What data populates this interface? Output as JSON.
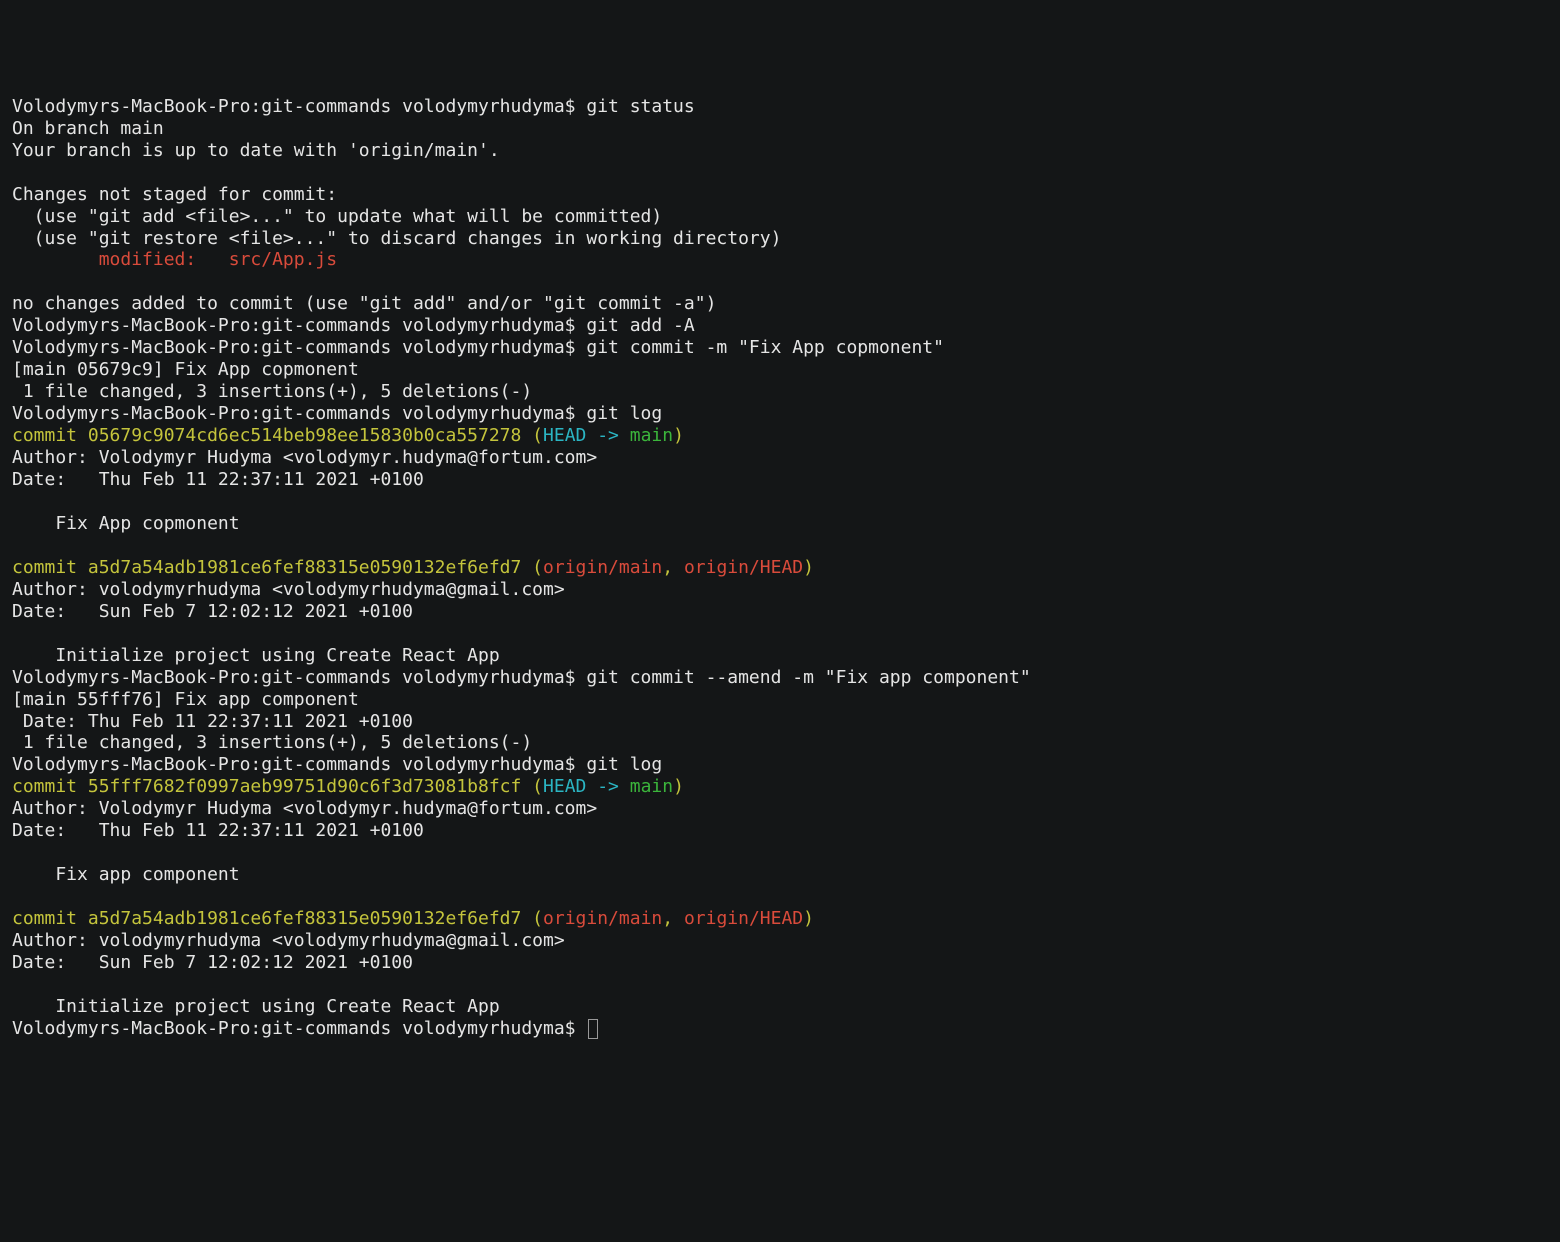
{
  "prompt": "Volodymyrs-MacBook-Pro:git-commands volodymyrhudyma$ ",
  "cmds": {
    "status": "git status",
    "add": "git add -A",
    "commit1": "git commit -m \"Fix App copmonent\"",
    "log1": "git log",
    "amend": "git commit --amend -m \"Fix app component\"",
    "log2": "git log"
  },
  "status": {
    "branch": "On branch main",
    "uptodate": "Your branch is up to date with 'origin/main'.",
    "notstaged": "Changes not staged for commit:",
    "hint_add": "  (use \"git add <file>...\" to update what will be committed)",
    "hint_restore": "  (use \"git restore <file>...\" to discard changes in working directory)",
    "modified": "        modified:   src/App.js",
    "noadded": "no changes added to commit (use \"git add\" and/or \"git commit -a\")"
  },
  "commit_result1": {
    "summary": "[main 05679c9] Fix App copmonent",
    "stats": " 1 file changed, 3 insertions(+), 5 deletions(-)"
  },
  "log_entry1": {
    "commit_prefix": "commit 05679c9074cd6ec514beb98ee15830b0ca557278",
    "paren_open": " (",
    "head": "HEAD -> ",
    "branch": "main",
    "paren_close": ")",
    "author": "Author: Volodymyr Hudyma <volodymyr.hudyma@fortum.com>",
    "date": "Date:   Thu Feb 11 22:37:11 2021 +0100",
    "msg": "    Fix App copmonent"
  },
  "log_entry2": {
    "commit_prefix": "commit a5d7a54adb1981ce6fef88315e0590132ef6efd7",
    "paren_open": " (",
    "remote1": "origin/main",
    "sep": ", ",
    "remote2": "origin/HEAD",
    "paren_close": ")",
    "author": "Author: volodymyrhudyma <volodymyrhudyma@gmail.com>",
    "date": "Date:   Sun Feb 7 12:02:12 2021 +0100",
    "msg": "    Initialize project using Create React App"
  },
  "amend_result": {
    "summary": "[main 55fff76] Fix app component",
    "date": " Date: Thu Feb 11 22:37:11 2021 +0100",
    "stats": " 1 file changed, 3 insertions(+), 5 deletions(-)"
  },
  "log_entry3": {
    "commit_prefix": "commit 55fff7682f0997aeb99751d90c6f3d73081b8fcf",
    "paren_open": " (",
    "head": "HEAD -> ",
    "branch": "main",
    "paren_close": ")",
    "author": "Author: Volodymyr Hudyma <volodymyr.hudyma@fortum.com>",
    "date": "Date:   Thu Feb 11 22:37:11 2021 +0100",
    "msg": "    Fix app component"
  }
}
